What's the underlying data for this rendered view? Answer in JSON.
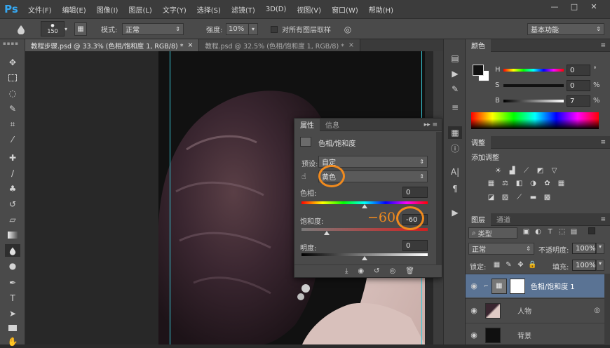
{
  "app": {
    "logo": "Ps"
  },
  "menu": [
    "文件(F)",
    "编辑(E)",
    "图像(I)",
    "图层(L)",
    "文字(Y)",
    "选择(S)",
    "滤镜(T)",
    "3D(D)",
    "视图(V)",
    "窗口(W)",
    "帮助(H)"
  ],
  "window_controls": {
    "minimize": "—",
    "maximize": "□",
    "close": "✕"
  },
  "options": {
    "brush_size": "150",
    "mode_label": "模式:",
    "mode_value": "正常",
    "strength_label": "强度:",
    "strength_value": "10%",
    "sample_all_label": "对所有图层取样",
    "workspace": "基本功能"
  },
  "tabs": [
    {
      "label": "教程步骤.psd @ 33.3% (色相/饱和度 1, RGB/8) *",
      "close": "×"
    },
    {
      "label": "教程.psd @ 32.5% (色相/饱和度 1, RGB/8) *",
      "close": "×"
    }
  ],
  "properties_panel": {
    "tab_properties": "属性",
    "tab_info": "信息",
    "title": "色相/饱和度",
    "preset_label": "预设:",
    "preset_value": "自定",
    "channel_value": "黄色",
    "hue_label": "色相:",
    "hue_value": "0",
    "hue_level": 0.5,
    "saturation_label": "饱和度:",
    "saturation_value": "-60",
    "saturation_annotation": "−60",
    "saturation_level": 0.2,
    "lightness_label": "明度:",
    "lightness_value": "0",
    "lightness_level": 0.5
  },
  "color_panel": {
    "tab": "颜色",
    "h_label": "H",
    "h_value": "0",
    "h_unit": "°",
    "s_label": "S",
    "s_value": "0",
    "s_unit": "%",
    "b_label": "B",
    "b_value": "7",
    "b_unit": "%"
  },
  "adjustments_panel": {
    "tab": "调整",
    "title": "添加调整"
  },
  "layers_panel": {
    "tab_layers": "图层",
    "tab_channels": "通道",
    "filter_kind": "类型",
    "blend_mode": "正常",
    "opacity_label": "不透明度:",
    "opacity_value": "100%",
    "lock_label": "锁定:",
    "fill_label": "填充:",
    "fill_value": "100%",
    "layers": [
      {
        "name": "色相/饱和度 1",
        "selected": true
      },
      {
        "name": "人物",
        "selected": false
      },
      {
        "name": "背景",
        "selected": false
      }
    ]
  },
  "colors": {
    "accent_orange": "#f08a1e",
    "guide_cyan": "#39c9d8",
    "ps_blue": "#36a7f0",
    "selected_layer": "#5a7394"
  }
}
